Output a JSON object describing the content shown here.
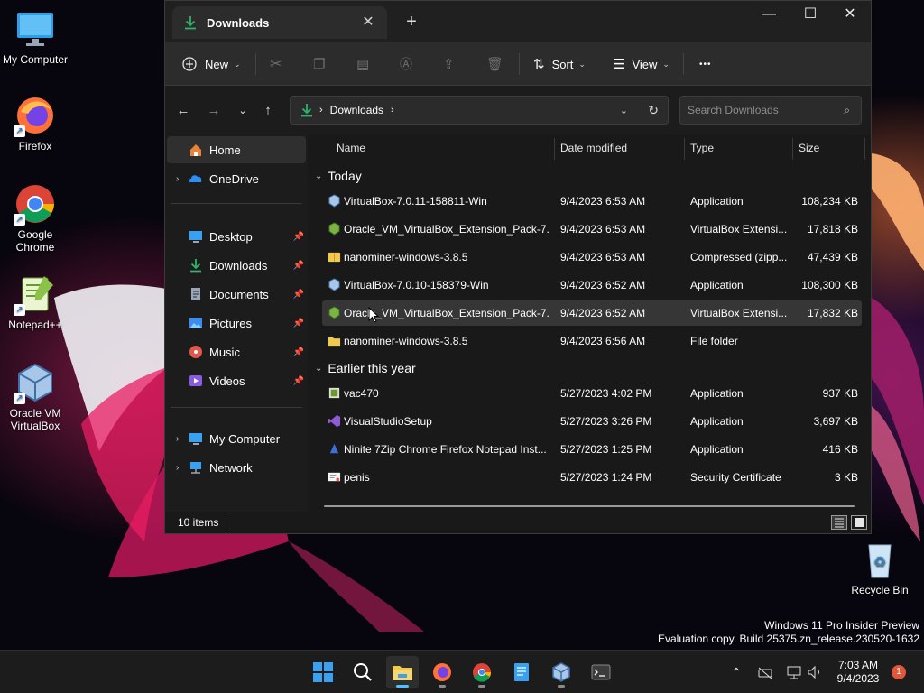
{
  "desktop": {
    "icons": [
      {
        "label": "My Computer",
        "icon": "monitor-icon"
      },
      {
        "label": "Firefox",
        "icon": "firefox-icon"
      },
      {
        "label": "Google Chrome",
        "icon": "chrome-icon"
      },
      {
        "label": "Notepad++",
        "icon": "notepadpp-icon"
      },
      {
        "label": "Oracle VM VirtualBox",
        "icon": "virtualbox-icon"
      },
      {
        "label": "Recycle Bin",
        "icon": "recycle-bin-icon"
      }
    ]
  },
  "window": {
    "tab_title": "Downloads",
    "controls": {
      "minimize": "—",
      "maximize": "☐",
      "close": "✕"
    },
    "toolbar": {
      "new_label": "New",
      "sort_label": "Sort",
      "view_label": "View",
      "more_label": "•••"
    },
    "address": {
      "crumb": "Downloads",
      "search_placeholder": "Search Downloads"
    },
    "sidebar": {
      "items": [
        {
          "label": "Home",
          "icon": "home-icon",
          "color": "#e8833a"
        },
        {
          "label": "OneDrive",
          "icon": "onedrive-icon",
          "color": "#2a8ff5"
        },
        {
          "label": "Desktop",
          "icon": "desktop-icon",
          "color": "#3aa0f0"
        },
        {
          "label": "Downloads",
          "icon": "download-icon",
          "color": "#2fb36b"
        },
        {
          "label": "Documents",
          "icon": "document-icon",
          "color": "#9aa6b8"
        },
        {
          "label": "Pictures",
          "icon": "picture-icon",
          "color": "#3a8cf0"
        },
        {
          "label": "Music",
          "icon": "music-icon",
          "color": "#e2564b"
        },
        {
          "label": "Videos",
          "icon": "video-icon",
          "color": "#8a5be0"
        },
        {
          "label": "My Computer",
          "icon": "computer-icon",
          "color": "#3aa0f0"
        },
        {
          "label": "Network",
          "icon": "network-icon",
          "color": "#3aa0f0"
        }
      ]
    },
    "columns": {
      "name": "Name",
      "date": "Date modified",
      "type": "Type",
      "size": "Size"
    },
    "groups": [
      {
        "label": "Today",
        "files": [
          {
            "name": "VirtualBox-7.0.11-158811-Win",
            "date": "9/4/2023 6:53 AM",
            "type": "Application",
            "size": "108,234 KB",
            "icon": "virtualbox-installer-icon"
          },
          {
            "name": "Oracle_VM_VirtualBox_Extension_Pack-7....",
            "date": "9/4/2023 6:53 AM",
            "type": "VirtualBox Extensi...",
            "size": "17,818 KB",
            "icon": "extension-pack-icon"
          },
          {
            "name": "nanominer-windows-3.8.5",
            "date": "9/4/2023 6:53 AM",
            "type": "Compressed (zipp...",
            "size": "47,439 KB",
            "icon": "zip-folder-icon"
          },
          {
            "name": "VirtualBox-7.0.10-158379-Win",
            "date": "9/4/2023 6:52 AM",
            "type": "Application",
            "size": "108,300 KB",
            "icon": "virtualbox-installer-icon"
          },
          {
            "name": "Oracle_VM_VirtualBox_Extension_Pack-7....",
            "date": "9/4/2023 6:52 AM",
            "type": "VirtualBox Extensi...",
            "size": "17,832 KB",
            "icon": "extension-pack-icon",
            "selected": true
          },
          {
            "name": "nanominer-windows-3.8.5",
            "date": "9/4/2023 6:56 AM",
            "type": "File folder",
            "size": "",
            "icon": "folder-icon"
          }
        ]
      },
      {
        "label": "Earlier this year",
        "files": [
          {
            "name": "vac470",
            "date": "5/27/2023 4:02 PM",
            "type": "Application",
            "size": "937 KB",
            "icon": "installer-icon"
          },
          {
            "name": "VisualStudioSetup",
            "date": "5/27/2023 3:26 PM",
            "type": "Application",
            "size": "3,697 KB",
            "icon": "visual-studio-icon"
          },
          {
            "name": "Ninite 7Zip Chrome Firefox Notepad Inst...",
            "date": "5/27/2023 1:25 PM",
            "type": "Application",
            "size": "416 KB",
            "icon": "ninite-icon"
          },
          {
            "name": "penis",
            "date": "5/27/2023 1:24 PM",
            "type": "Security Certificate",
            "size": "3 KB",
            "icon": "certificate-icon"
          }
        ]
      }
    ],
    "status": {
      "count": "10 items"
    }
  },
  "watermark": {
    "line1": "Windows 11 Pro Insider Preview",
    "line2": "Evaluation copy. Build 25375.zn_release.230520-1632"
  },
  "taskbar": {
    "clock_time": "7:03 AM",
    "clock_date": "9/4/2023",
    "notification_count": "1"
  }
}
